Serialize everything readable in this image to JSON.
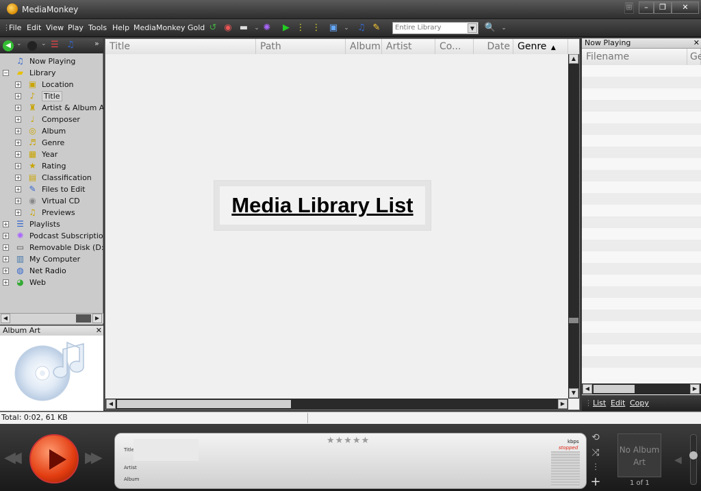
{
  "app": {
    "title": "MediaMonkey"
  },
  "menu": {
    "items": [
      "File",
      "Edit",
      "View",
      "Play",
      "Tools",
      "Help",
      "MediaMonkey Gold"
    ]
  },
  "search": {
    "scope": "Entire Library"
  },
  "tree": {
    "items": [
      {
        "label": "Now Playing",
        "icon": "now-playing-icon"
      },
      {
        "label": "Library",
        "icon": "library-folder-icon"
      },
      {
        "label": "Location",
        "icon": "location-icon"
      },
      {
        "label": "Title",
        "icon": "title-icon",
        "selected": true
      },
      {
        "label": "Artist & Album Artist",
        "icon": "artist-icon"
      },
      {
        "label": "Composer",
        "icon": "composer-icon"
      },
      {
        "label": "Album",
        "icon": "album-icon"
      },
      {
        "label": "Genre",
        "icon": "genre-icon"
      },
      {
        "label": "Year",
        "icon": "year-icon"
      },
      {
        "label": "Rating",
        "icon": "rating-icon"
      },
      {
        "label": "Classification",
        "icon": "classification-icon"
      },
      {
        "label": "Files to Edit",
        "icon": "files-to-edit-icon"
      },
      {
        "label": "Virtual CD",
        "icon": "virtual-cd-icon"
      },
      {
        "label": "Previews",
        "icon": "previews-icon"
      },
      {
        "label": "Playlists",
        "icon": "playlists-icon"
      },
      {
        "label": "Podcast Subscriptions",
        "icon": "podcast-icon"
      },
      {
        "label": "Removable Disk (D:)",
        "icon": "removable-disk-icon"
      },
      {
        "label": "My Computer",
        "icon": "computer-icon"
      },
      {
        "label": "Net Radio",
        "icon": "net-radio-icon"
      },
      {
        "label": "Web",
        "icon": "web-icon"
      }
    ]
  },
  "albumart": {
    "title": "Album Art"
  },
  "list": {
    "columns": [
      "Title",
      "Path",
      "Album",
      "Artist",
      "Co...",
      "Date",
      "Genre"
    ],
    "placeholder": "Media Library List"
  },
  "nowplaying": {
    "title": "Now Playing",
    "column": "Filename",
    "column2": "Ge",
    "actions": [
      "List",
      "Edit",
      "Copy"
    ]
  },
  "status": {
    "text": "Total: 0:02, 61 KB"
  },
  "player": {
    "title_label": "Title",
    "artist_label": "Artist",
    "album_label": "Album",
    "kbps": "kbps",
    "state": "stopped",
    "no_art": "No Album Art",
    "pager": "1 of 1",
    "rating_stars": "★★★★★"
  },
  "colors": {
    "accent": "#e23c10",
    "chrome": "#2e2e2e",
    "panel": "#cbcbcb"
  }
}
